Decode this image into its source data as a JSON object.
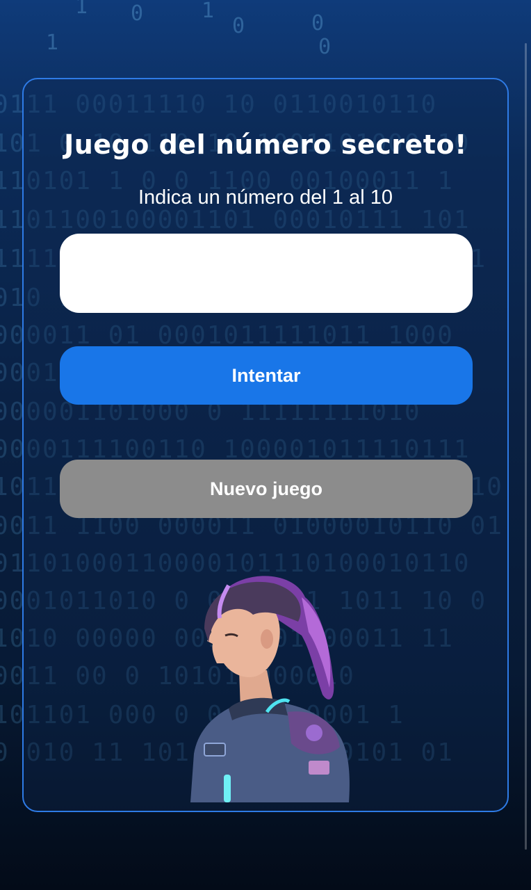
{
  "game": {
    "title": "Juego del número secreto!",
    "instruction": "Indica un número del 1 al 10",
    "input_value": "",
    "try_button_label": "Intentar",
    "new_game_button_label": "Nuevo juego"
  },
  "background": {
    "binary_rows": [
      "0111 00011110 10 0110010110",
      "101 0 10 110 10 1001101000 10",
      "110101 1 0 0 1100 00100011 1",
      "1101100100001101 00010111 101",
      "1111011 100 100 1 110010 00001",
      "010 1100001000 0 0 1 00 1",
      "000011 01 0001011111011 1000",
      "000101 0 0 00 0 110 10 010",
      "000001101000 0 11111111010",
      "0000111100110 100001011110111",
      "1011100100101 000 1101 111 1110",
      "0011 1100 000011 01000010110 01",
      "01101000110000101110100010110",
      "0001011010 0 01 1011 1011 10 0",
      "1010 00000 001 0001100011 11",
      "0011 00 0 101011000010",
      "101101 000 0 0 110 0001 1",
      "0 010 11 101 0 01 1100101 01"
    ]
  },
  "colors": {
    "accent_blue": "#1976e8",
    "card_border": "#2e7be6",
    "new_game_gray": "#8c8c8c"
  }
}
